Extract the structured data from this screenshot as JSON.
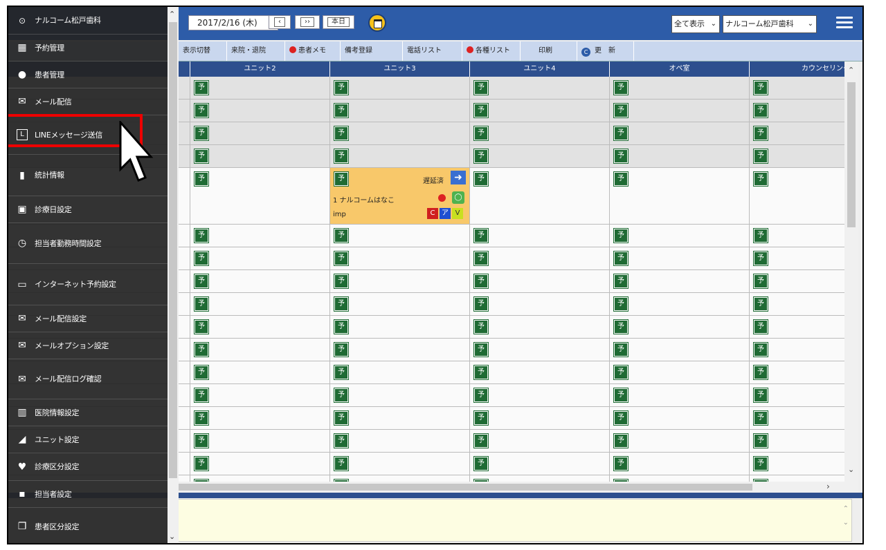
{
  "topbar": {
    "date": "2017/2/16 (木)",
    "btn_prev": "‹",
    "btn_next": "››",
    "btn_today": "本日",
    "view_select": "全て表示",
    "clinic_select": "ナルコーム松戸歯科"
  },
  "toolbar": {
    "items": [
      "表示切替",
      "来院・退院",
      "患者メモ",
      "備考登録",
      "電話リスト",
      "各種リスト",
      "印刷",
      "更　新"
    ]
  },
  "columns": [
    "ユニット2",
    "ユニット3",
    "ユニット4",
    "オペ室",
    "カウンセリング"
  ],
  "slot_label": "予",
  "appointment": {
    "status": "遅延済",
    "patient": "1 ナルコームはなこ",
    "memo": "imp",
    "tags": [
      "C",
      "ア",
      "V"
    ]
  },
  "sidebar": {
    "header": "ナルコーム松戸歯科",
    "items": [
      {
        "label": "予約管理",
        "icon": "calendar-grid-icon"
      },
      {
        "label": "患者管理",
        "icon": "person-icon"
      },
      {
        "label": "メール配信",
        "icon": "mail-icon"
      },
      {
        "label": "LINEメッセージ送信",
        "icon": "line-icon"
      },
      {
        "label": "統計情報",
        "icon": "bar-chart-icon"
      },
      {
        "label": "診療日設定",
        "icon": "calendar-icon"
      },
      {
        "label": "担当者勤務時間設定",
        "icon": "staff-clock-icon"
      },
      {
        "label": "インターネット予約設定",
        "icon": "monitor-icon"
      },
      {
        "label": "メール配信設定",
        "icon": "mail-settings-icon"
      },
      {
        "label": "メールオプション設定",
        "icon": "mail-plus-icon"
      },
      {
        "label": "メール配信ログ確認",
        "icon": "mail-log-icon"
      },
      {
        "label": "医院情報設定",
        "icon": "clinic-icon"
      },
      {
        "label": "ユニット設定",
        "icon": "dental-chair-icon"
      },
      {
        "label": "診療区分設定",
        "icon": "tooth-icon"
      },
      {
        "label": "担当者設定",
        "icon": "staff-icon"
      },
      {
        "label": "患者区分設定",
        "icon": "patient-category-icon"
      }
    ]
  }
}
